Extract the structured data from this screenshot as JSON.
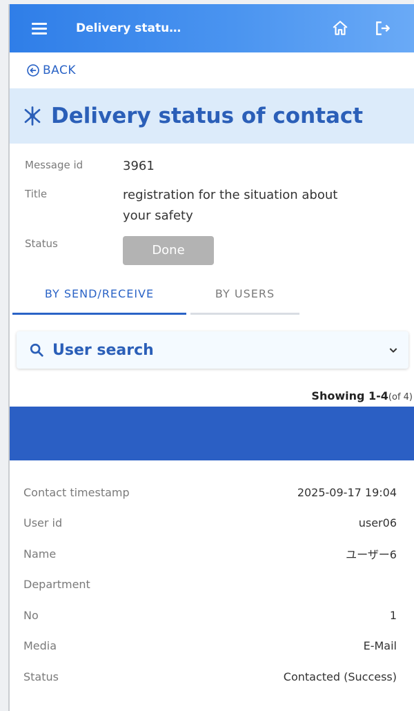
{
  "header": {
    "title": "Delivery statu…",
    "menu_icon": "menu-icon",
    "home_icon": "home-icon",
    "logout_icon": "logout-icon"
  },
  "back": {
    "label": "BACK"
  },
  "page": {
    "title": "Delivery status of contact"
  },
  "info": {
    "message_id_label": "Message id",
    "message_id": "3961",
    "title_label": "Title",
    "title_line1": "registration for the situation about",
    "title_line2": "your safety",
    "status_label": "Status",
    "status_value": "Done"
  },
  "tabs": [
    {
      "label": "BY SEND/RECEIVE",
      "active": true
    },
    {
      "label": "BY USERS",
      "active": false
    }
  ],
  "search": {
    "label": "User search"
  },
  "showing": {
    "range": "Showing 1-4",
    "total": "(of 4)"
  },
  "record": {
    "rows": [
      {
        "label": "Contact timestamp",
        "value": "2025-09-17 19:04"
      },
      {
        "label": "User id",
        "value": "user06"
      },
      {
        "label": "Name",
        "value": "ユーザー6"
      },
      {
        "label": "Department",
        "value": ""
      },
      {
        "label": "No",
        "value": "1"
      },
      {
        "label": "Media",
        "value": "E-Mail"
      },
      {
        "label": "Status",
        "value": "Contacted (Success)"
      }
    ]
  },
  "colors": {
    "header_start": "#2f7ee8",
    "header_end": "#6aaaf6",
    "accent": "#2a63c6",
    "title_bg": "#dcebfa",
    "bar": "#2b5fc4",
    "status_btn": "#b3b3b3"
  }
}
